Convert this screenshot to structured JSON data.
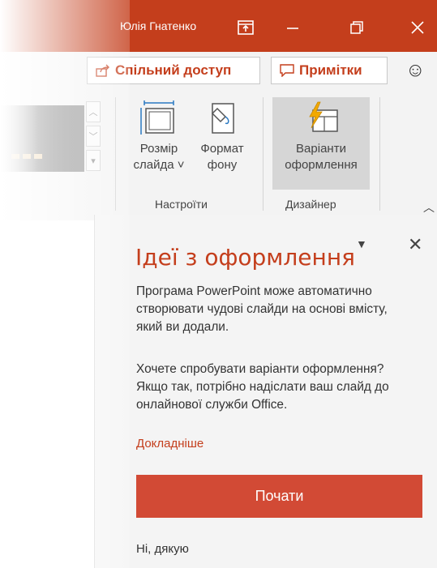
{
  "titlebar": {
    "user_name": "Юлія Гнатенко",
    "color": "#c43e1c"
  },
  "ribbon": {
    "share_label": "Спільний доступ",
    "comments_label": "Примітки",
    "slide_size": {
      "line1": "Розмір",
      "line2": "слайда ˅"
    },
    "format_bg": {
      "line1": "Формат",
      "line2": "фону"
    },
    "design_ideas": {
      "line1": "Варіанти",
      "line2": "оформлення"
    },
    "group_customize": "Настроїти",
    "group_designer": "Дизайнер"
  },
  "panel": {
    "title": "Ідеї з оформлення",
    "para1": "Програма PowerPoint може автоматично створювати чудові слайди на основі вмісту, який ви додали.",
    "para2": "Хочете спробувати варіанти оформлення? Якщо так, потрібно надіслати ваш слайд до онлайнової служби Office.",
    "learn_more": "Докладніше",
    "start_button": "Почати",
    "no_thanks": "Ні, дякую",
    "accent_color": "#c43e1c",
    "button_color": "#d24a35"
  }
}
